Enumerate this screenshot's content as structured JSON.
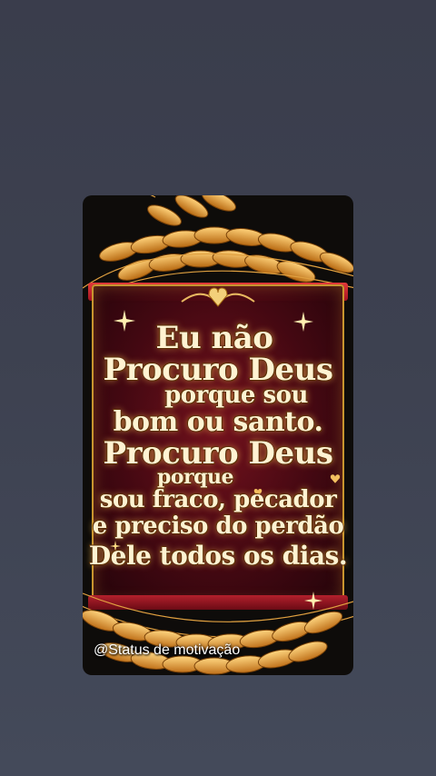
{
  "post": {
    "quote_lines": [
      "Eu não",
      "Procuro Deus",
      "porque sou",
      "bom ou santo.",
      "Procuro Deus",
      "porque",
      "sou fraco, pecador",
      "e preciso do perdão",
      "Dele todos os dias."
    ],
    "watermark": "@Status de motivação"
  },
  "colors": {
    "background": "#3d4150",
    "banner_red": "#7a1020",
    "gold": "#c8952f",
    "text": "#fff3d2"
  },
  "icons": [
    "wheat-icon",
    "heart-icon",
    "sparkle-icon"
  ]
}
